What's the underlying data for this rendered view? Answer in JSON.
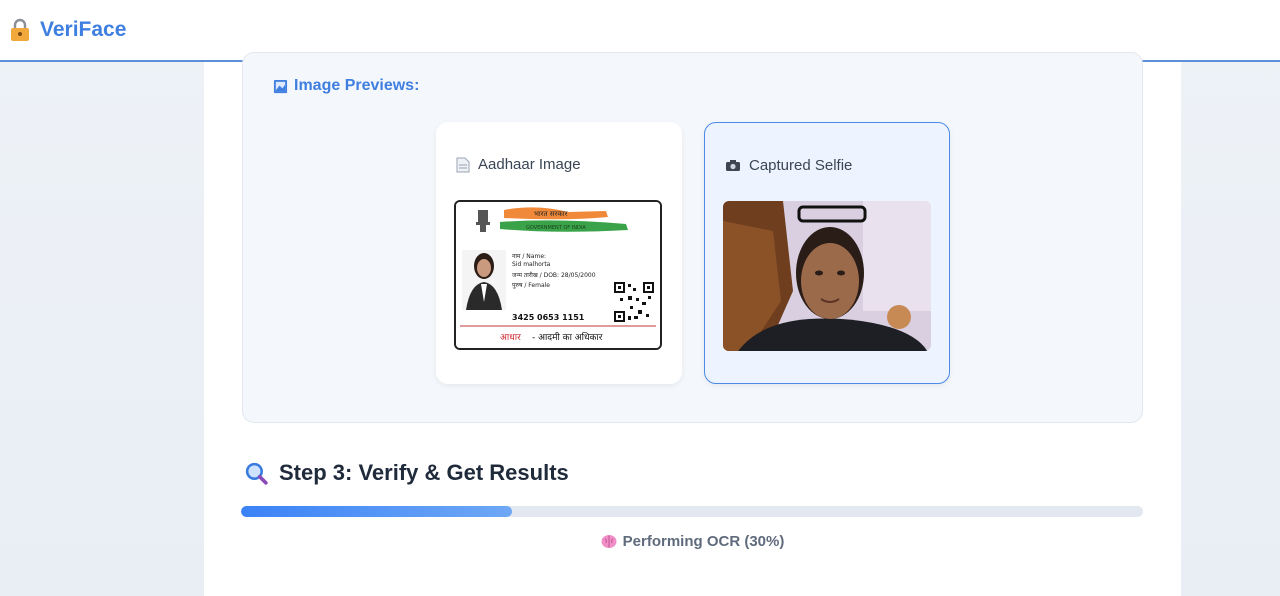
{
  "app": {
    "title": "VeriFace",
    "lock_icon": "lock-icon"
  },
  "previews": {
    "heading": "Image Previews:",
    "heading_icon": "image-icon",
    "aadhaar": {
      "label": "Aadhaar Image",
      "icon": "document-icon",
      "card": {
        "hindi_header": "भारत सरकार",
        "gov_line": "GOVERNMENT OF INDIA",
        "name_label": "नाम / Name:",
        "name_value": "Sid malhorta",
        "dob_line": "जन्म तारीख / DOB: 28/05/2000",
        "gender_line": "पुरुष / Female",
        "number": "3425 0653 1151",
        "footer_red": "आधार",
        "footer_black": "- आदमी का अधिकार"
      }
    },
    "selfie": {
      "label": "Captured Selfie",
      "icon": "camera-icon"
    }
  },
  "step3": {
    "title": "Step 3: Verify & Get Results",
    "icon": "magnifier-icon",
    "progress_fraction": 0.3,
    "status": "Performing OCR (30%)",
    "status_icon": "brain-icon"
  },
  "colors": {
    "accent": "#3f7fe0",
    "progress": "#3b82f6"
  }
}
